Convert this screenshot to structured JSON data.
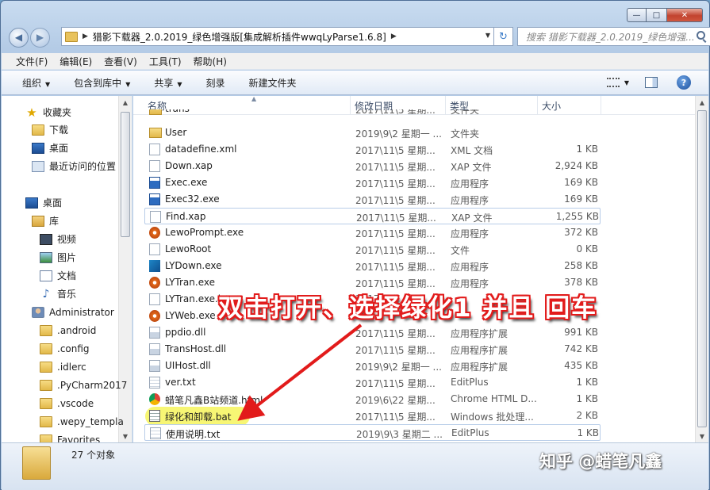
{
  "window": {
    "caption_buttons": {
      "minimize": "—",
      "maximize": "□",
      "close": "✕"
    }
  },
  "nav": {
    "back_icon": "back-arrow-icon",
    "forward_icon": "forward-arrow-icon",
    "address_separator": "▶",
    "address_path": "猎影下载器_2.0.2019_绿色增强版[集成解析插件wwqLyParse1.6.8]",
    "address_trailing_separator": "▶",
    "search_placeholder": "搜索 猎影下载器_2.0.2019_绿色增强..."
  },
  "menu": [
    "文件(F)",
    "编辑(E)",
    "查看(V)",
    "工具(T)",
    "帮助(H)"
  ],
  "toolbar": {
    "organize": "组织",
    "include_library": "包含到库中",
    "share": "共享",
    "burn": "刻录",
    "new_folder": "新建文件夹"
  },
  "navpane": [
    {
      "label": "收藏夹",
      "icon": "star-icon",
      "indent": 0
    },
    {
      "label": "下载",
      "icon": "folder-icon",
      "indent": 1
    },
    {
      "label": "桌面",
      "icon": "desktop-icon",
      "indent": 1
    },
    {
      "label": "最近访问的位置",
      "icon": "recent-places-icon",
      "indent": 1
    },
    {
      "label": "",
      "icon": "",
      "indent": 0
    },
    {
      "label": "桌面",
      "icon": "desktop-icon",
      "indent": 0
    },
    {
      "label": "库",
      "icon": "library-icon",
      "indent": 1
    },
    {
      "label": "视频",
      "icon": "video-icon",
      "indent": 2
    },
    {
      "label": "图片",
      "icon": "picture-icon",
      "indent": 2
    },
    {
      "label": "文档",
      "icon": "document-icon",
      "indent": 2
    },
    {
      "label": "音乐",
      "icon": "music-icon",
      "indent": 2
    },
    {
      "label": "Administrator",
      "icon": "user-icon",
      "indent": 1
    },
    {
      "label": ".android",
      "icon": "folder-icon",
      "indent": 2
    },
    {
      "label": ".config",
      "icon": "folder-icon",
      "indent": 2
    },
    {
      "label": ".idlerc",
      "icon": "folder-icon",
      "indent": 2
    },
    {
      "label": ".PyCharm2017",
      "icon": "folder-icon",
      "indent": 2
    },
    {
      "label": ".vscode",
      "icon": "folder-icon",
      "indent": 2
    },
    {
      "label": ".wepy_templa",
      "icon": "folder-icon",
      "indent": 2
    },
    {
      "label": "Favorites",
      "icon": "folder-icon",
      "indent": 2
    }
  ],
  "columns": {
    "name": "名称",
    "modified": "修改日期",
    "type": "类型",
    "size": "大小"
  },
  "files": [
    {
      "name": "trans",
      "date": "2017\\11\\5 星期...",
      "type": "文件夹",
      "size": "",
      "icon": "folder-icon"
    },
    {
      "name": "User",
      "date": "2019\\9\\2 星期一 ...",
      "type": "文件夹",
      "size": "",
      "icon": "folder-icon"
    },
    {
      "name": "datadefine.xml",
      "date": "2017\\11\\5 星期...",
      "type": "XML 文档",
      "size": "1 KB",
      "icon": "xml-file-icon"
    },
    {
      "name": "Down.xap",
      "date": "2017\\11\\5 星期...",
      "type": "XAP 文件",
      "size": "2,924 KB",
      "icon": "file-icon"
    },
    {
      "name": "Exec.exe",
      "date": "2017\\11\\5 星期...",
      "type": "应用程序",
      "size": "169 KB",
      "icon": "exe-icon"
    },
    {
      "name": "Exec32.exe",
      "date": "2017\\11\\5 星期...",
      "type": "应用程序",
      "size": "169 KB",
      "icon": "exe-icon"
    },
    {
      "name": "Find.xap",
      "date": "2017\\11\\5 星期...",
      "type": "XAP 文件",
      "size": "1,255 KB",
      "icon": "file-icon"
    },
    {
      "name": "LewoPrompt.exe",
      "date": "2017\\11\\5 星期...",
      "type": "应用程序",
      "size": "372 KB",
      "icon": "app-icon"
    },
    {
      "name": "LewoRoot",
      "date": "2017\\11\\5 星期...",
      "type": "文件",
      "size": "0 KB",
      "icon": "file-icon"
    },
    {
      "name": "LYDown.exe",
      "date": "2017\\11\\5 星期...",
      "type": "应用程序",
      "size": "258 KB",
      "icon": "lydown-icon"
    },
    {
      "name": "LYTran.exe",
      "date": "2017\\11\\5 星期...",
      "type": "应用程序",
      "size": "378 KB",
      "icon": "app-icon"
    },
    {
      "name": "LYTran.exe.in",
      "date": "2017",
      "type": "",
      "size": "",
      "icon": "file-icon"
    },
    {
      "name": "LYWeb.exe",
      "date": "201",
      "type": "",
      "size": "",
      "icon": "app-icon"
    },
    {
      "name": "ppdio.dll",
      "date": "2017\\11\\5 星期...",
      "type": "应用程序扩展",
      "size": "991 KB",
      "icon": "dll-icon"
    },
    {
      "name": "TransHost.dll",
      "date": "2017\\11\\5 星期...",
      "type": "应用程序扩展",
      "size": "742 KB",
      "icon": "dll-icon"
    },
    {
      "name": "UIHost.dll",
      "date": "2019\\9\\2 星期一 ...",
      "type": "应用程序扩展",
      "size": "435 KB",
      "icon": "dll-icon"
    },
    {
      "name": "ver.txt",
      "date": "2017\\11\\5 星期...",
      "type": "EditPlus",
      "size": "1 KB",
      "icon": "txt-icon"
    },
    {
      "name": "蜡笔凡鑫B站频道.html",
      "date": "2019\\6\\22 星期...",
      "type": "Chrome HTML D...",
      "size": "1 KB",
      "icon": "chrome-icon"
    },
    {
      "name": "绿化和卸载.bat",
      "date": "2017\\11\\5 星期...",
      "type": "Windows 批处理...",
      "size": "2 KB",
      "icon": "bat-icon"
    },
    {
      "name": "使用说明.txt",
      "date": "2019\\9\\3 星期二 ...",
      "type": "EditPlus",
      "size": "1 KB",
      "icon": "txt-icon"
    }
  ],
  "status": {
    "count": "27 个对象"
  },
  "annotation": {
    "text": "双击打开、选择绿化1 并且 回车",
    "color": "#e21b1b"
  },
  "watermark": "知乎 @蜡笔凡鑫"
}
